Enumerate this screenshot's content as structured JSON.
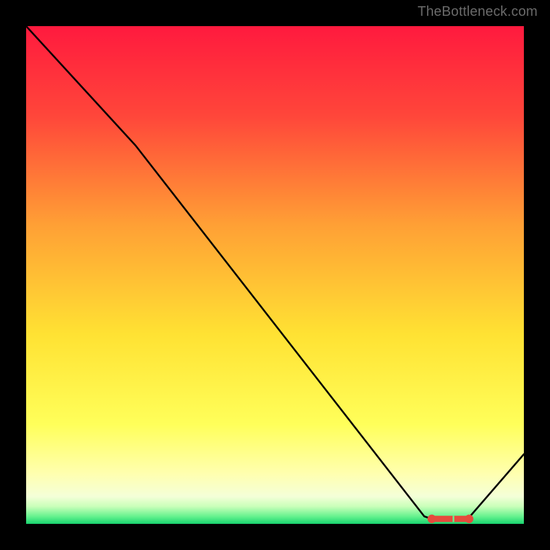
{
  "attribution": "TheBottleneck.com",
  "chart_data": {
    "type": "line",
    "title": "",
    "xlabel": "",
    "ylabel": "",
    "x": [
      0,
      22,
      80,
      81.5,
      83,
      84.5,
      86,
      87.5,
      89,
      100
    ],
    "values": [
      100,
      76,
      1.5,
      1,
      1,
      1,
      1,
      1,
      1.3,
      14
    ],
    "xlim": [
      0,
      100
    ],
    "ylim": [
      0,
      100
    ],
    "flat_region": {
      "start_x": 81.5,
      "end_x": 89
    },
    "markers": {
      "style": "sausage",
      "color": "#e64a3c",
      "points_x": [
        81.5,
        83,
        84.5,
        86,
        87.5,
        89
      ]
    },
    "background": {
      "type": "vertical-gradient",
      "stops": [
        {
          "pos": 0.0,
          "color": "#ff1a3e"
        },
        {
          "pos": 0.18,
          "color": "#ff463a"
        },
        {
          "pos": 0.4,
          "color": "#ffa035"
        },
        {
          "pos": 0.62,
          "color": "#ffe233"
        },
        {
          "pos": 0.8,
          "color": "#ffff5a"
        },
        {
          "pos": 0.9,
          "color": "#ffffb0"
        },
        {
          "pos": 0.945,
          "color": "#f4ffd8"
        },
        {
          "pos": 0.965,
          "color": "#c9ffb9"
        },
        {
          "pos": 0.985,
          "color": "#66f28e"
        },
        {
          "pos": 1.0,
          "color": "#18d46f"
        }
      ]
    }
  }
}
